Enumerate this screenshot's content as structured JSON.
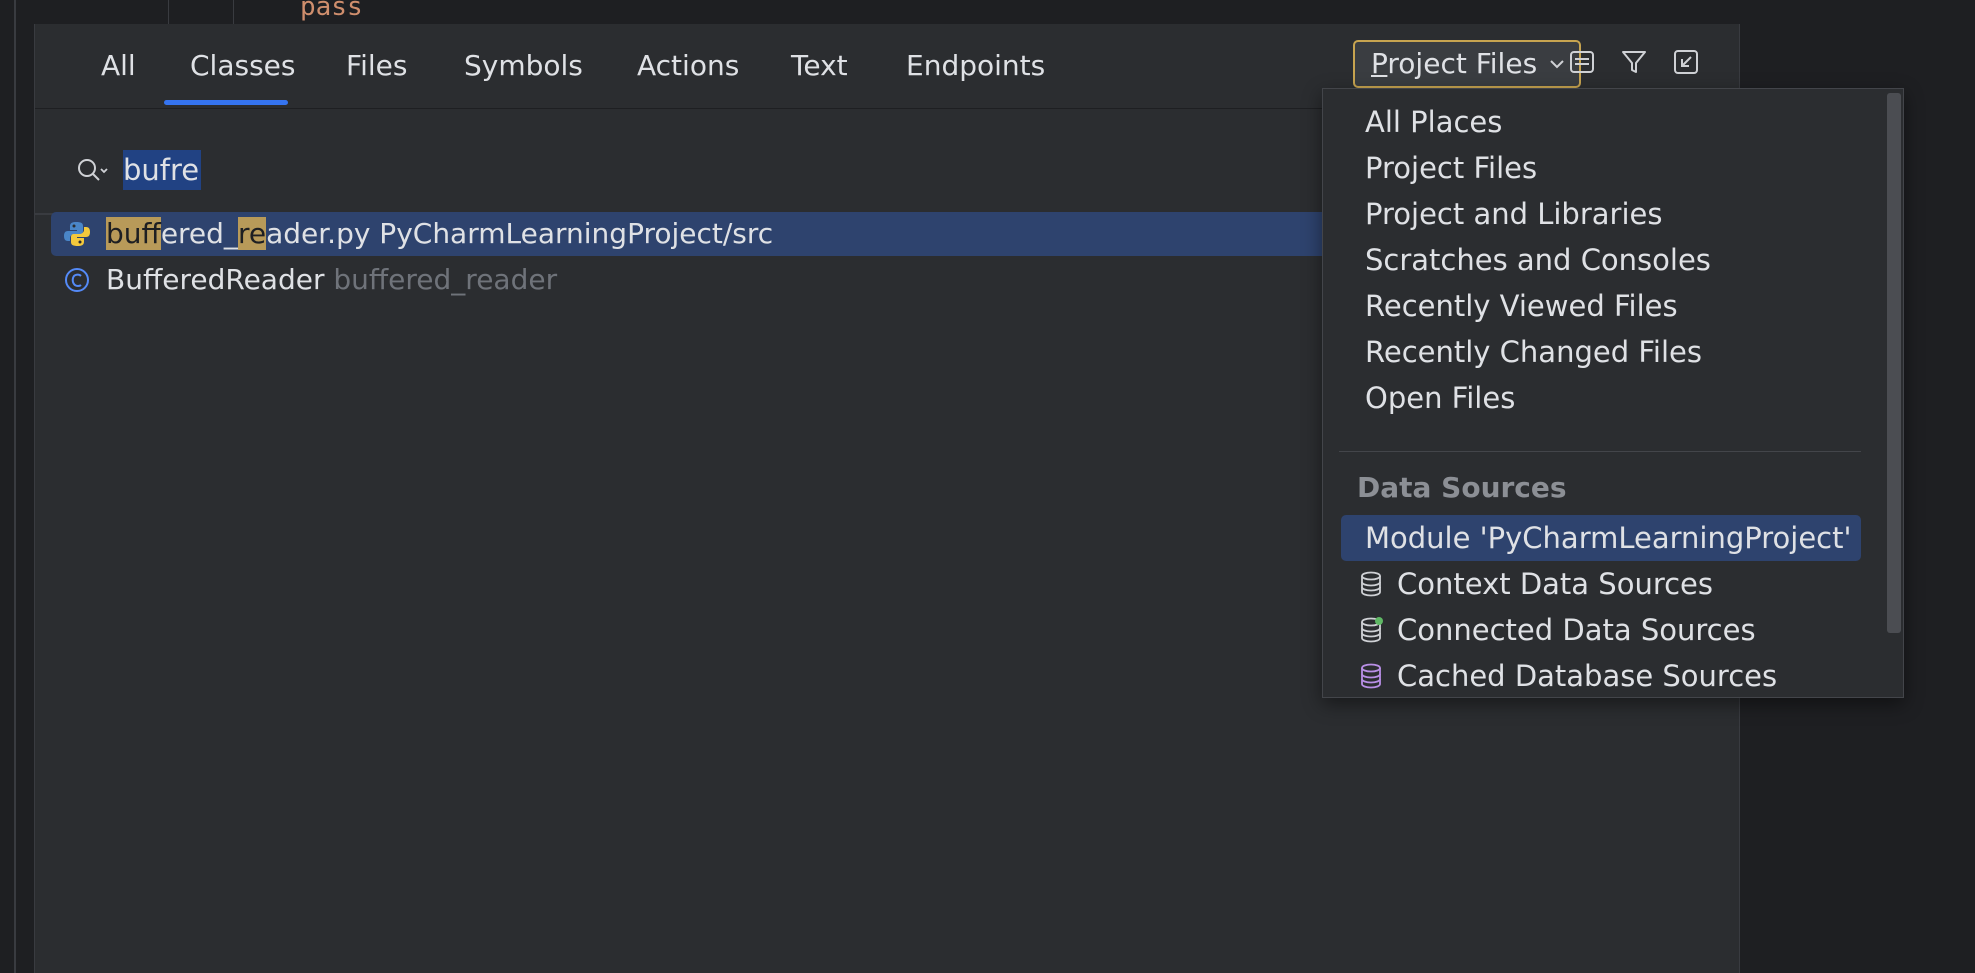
{
  "editor": {
    "code_fragment": "pass"
  },
  "tabs": [
    {
      "label": "All"
    },
    {
      "label": "Classes"
    },
    {
      "label": "Files"
    },
    {
      "label": "Symbols"
    },
    {
      "label": "Actions"
    },
    {
      "label": "Text"
    },
    {
      "label": "Endpoints"
    }
  ],
  "active_tab": "Classes",
  "scope_button": {
    "first_letter": "P",
    "rest": "roject Files"
  },
  "toolbar_icons": [
    "preview-icon",
    "filter-icon",
    "open-in-window-icon"
  ],
  "search": {
    "value": "bufre"
  },
  "results": [
    {
      "icon": "python-file-icon",
      "parts": [
        {
          "text": "buf",
          "hl": true
        },
        {
          "text": "fered_",
          "hl": false
        },
        {
          "text": "re",
          "hl": true
        },
        {
          "text": "ader.py PyCharmLearningProject/src",
          "hl": false
        }
      ]
    },
    {
      "icon": "class-icon",
      "name": "BufferedReader",
      "location": "buffered_reader"
    }
  ],
  "dropdown": {
    "items": [
      {
        "label": "All Places"
      },
      {
        "label": "Project Files"
      },
      {
        "label": "Project and Libraries"
      },
      {
        "label": "Scratches and Consoles"
      },
      {
        "label": "Recently Viewed Files"
      },
      {
        "label": "Recently Changed Files"
      },
      {
        "label": "Open Files"
      }
    ],
    "group_label": "Data Sources",
    "group_items": [
      {
        "label": "Module 'PyCharmLearningProject'",
        "selected": true
      },
      {
        "label": "Context Data Sources",
        "icon": "database-icon"
      },
      {
        "label": "Connected Data Sources",
        "icon": "database-connected-icon"
      },
      {
        "label": "Cached Database Sources",
        "icon": "database-cached-icon"
      }
    ]
  },
  "colors": {
    "accent": "#3574f0",
    "selection": "#2e436e",
    "match_highlight": "#b89a59",
    "scope_border": "#c7a450"
  }
}
